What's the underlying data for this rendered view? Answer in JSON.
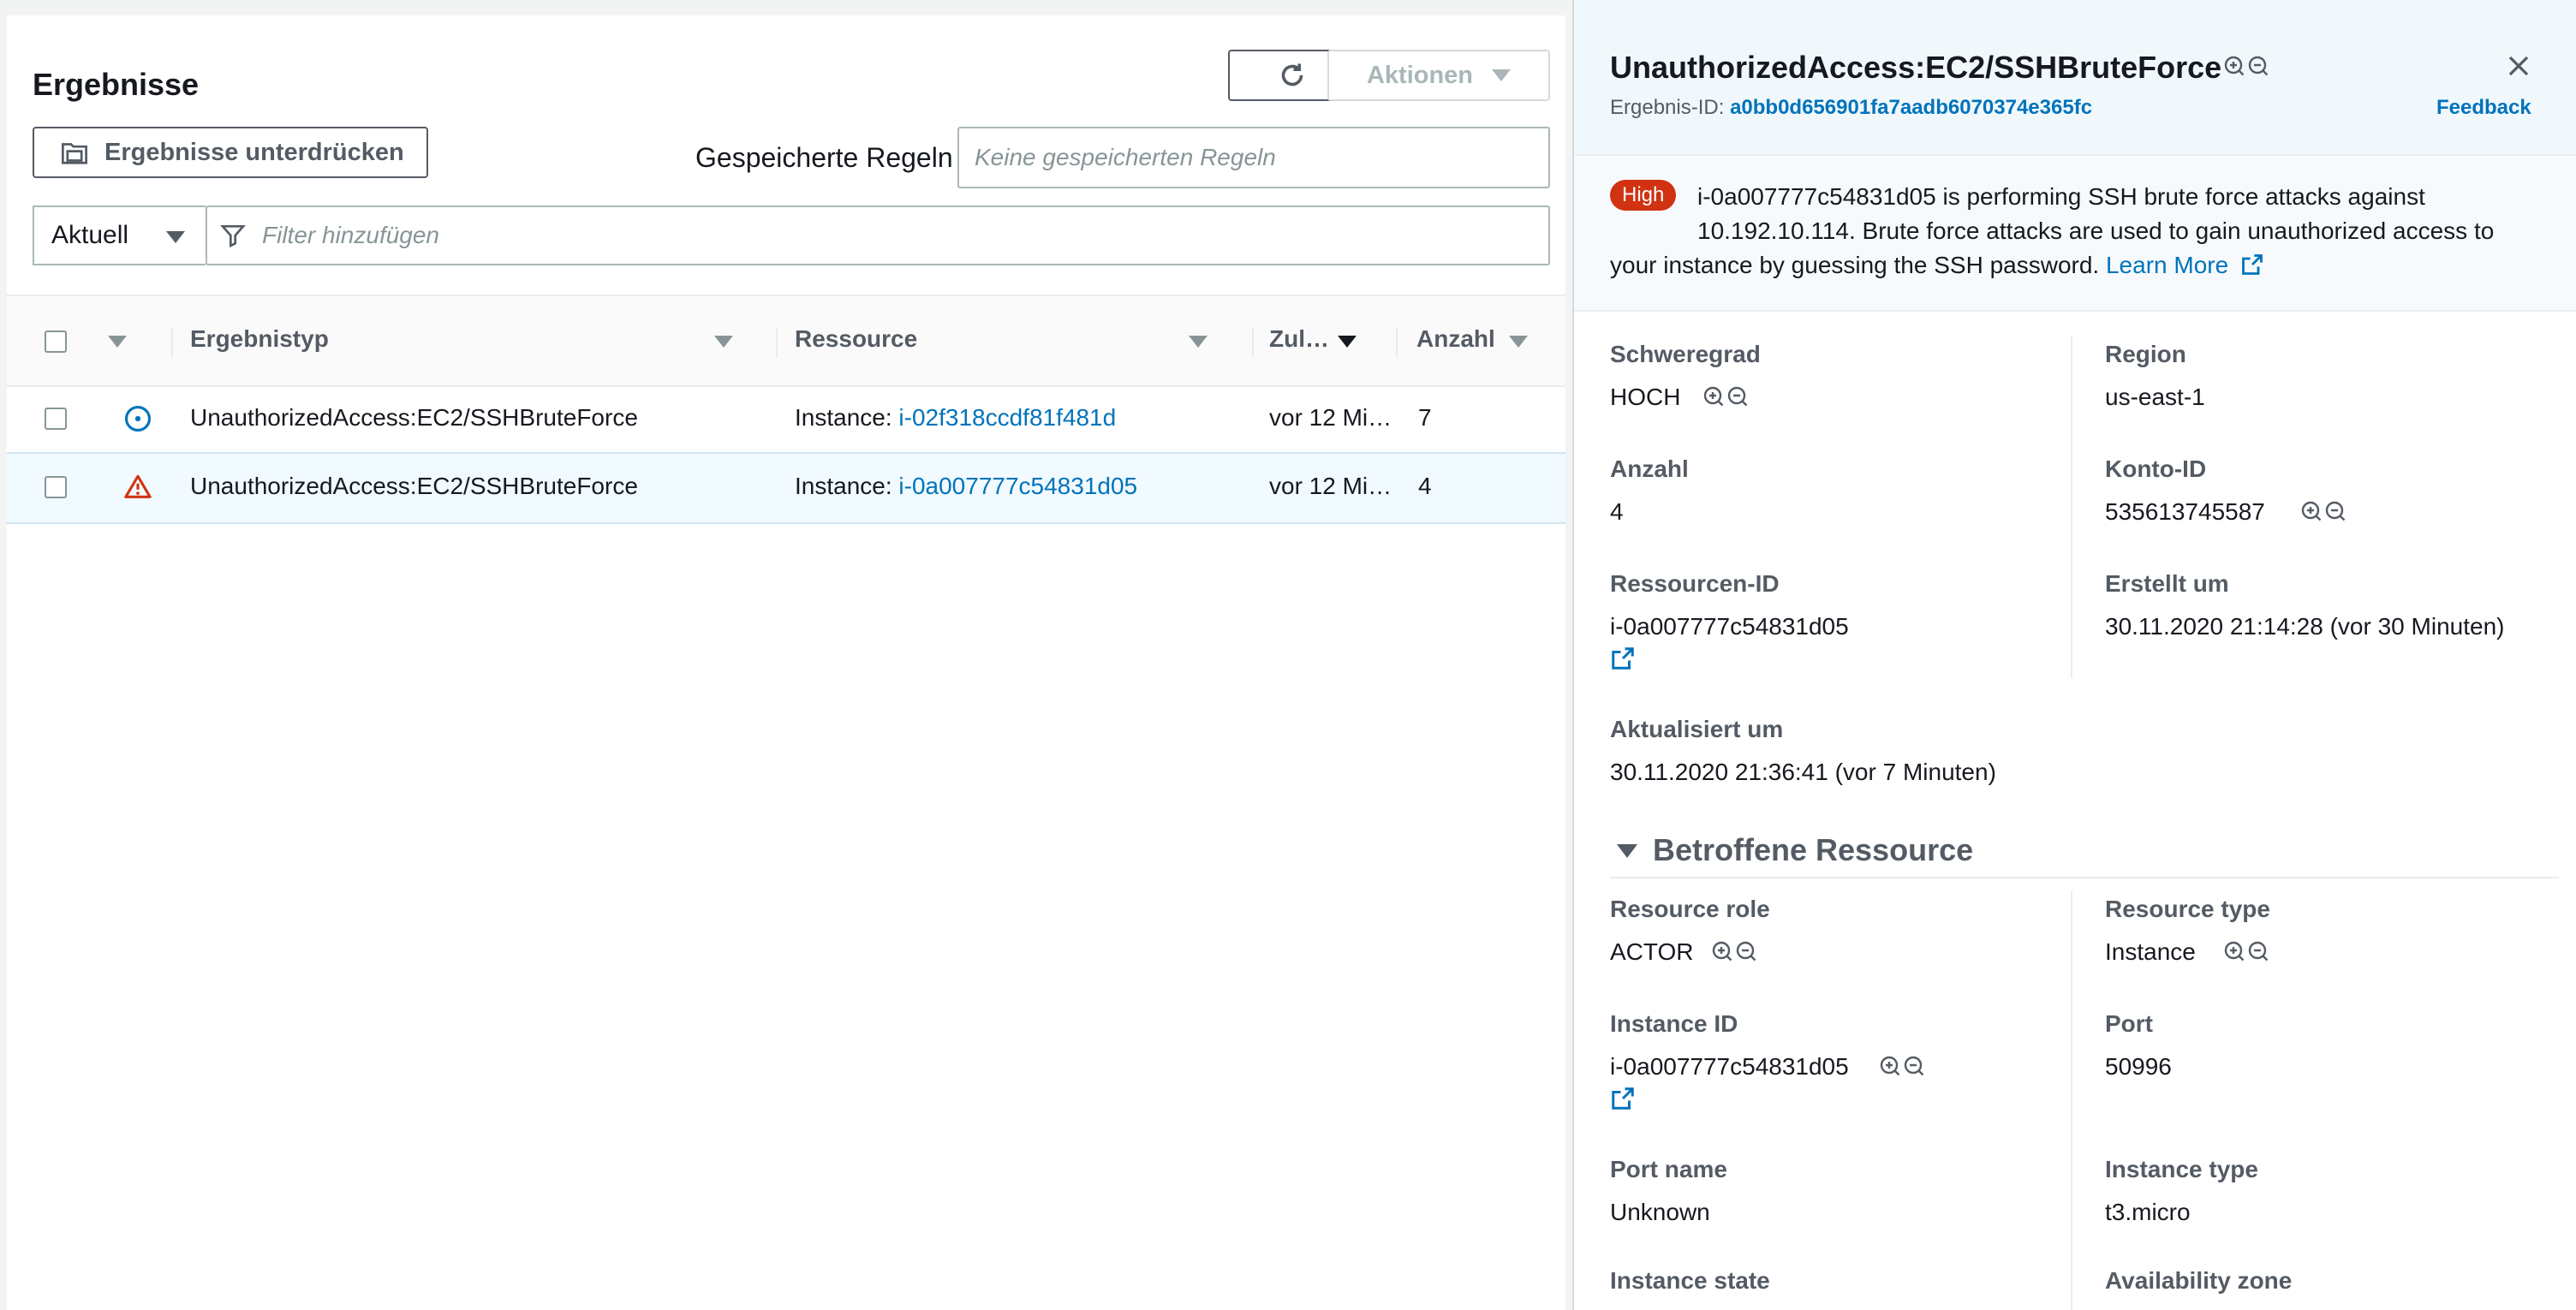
{
  "left": {
    "title": "Ergebnisse",
    "refresh_icon": "refresh-icon",
    "actions_label": "Aktionen",
    "suppress_label": "Ergebnisse unterdrücken",
    "saved_rules_label": "Gespeicherte Regeln",
    "saved_rules_placeholder": "Keine gespeicherten Regeln",
    "view_select": "Aktuell",
    "filter_placeholder": "Filter hinzufügen",
    "columns": [
      "Ergebnistyp",
      "Ressource",
      "Zul…",
      "Anzahl"
    ],
    "rows": [
      {
        "severity_icon": "info-circle-icon",
        "type": "UnauthorizedAccess:EC2/SSHBruteForce",
        "resource_prefix": "Instance: ",
        "resource_link": "i-02f318ccdf81f481d",
        "updated": "vor 12 Mi…",
        "count": "7",
        "selected": false
      },
      {
        "severity_icon": "warning-triangle-icon",
        "type": "UnauthorizedAccess:EC2/SSHBruteForce",
        "resource_prefix": "Instance: ",
        "resource_link": "i-0a007777c54831d05",
        "updated": "vor 12 Mi…",
        "count": "4",
        "selected": true
      }
    ]
  },
  "detail": {
    "title": "UnauthorizedAccess:EC2/SSHBruteForce",
    "finding_id_label": "Ergebnis-ID:",
    "finding_id": "a0bb0d656901fa7aadb6070374e365fc",
    "feedback": "Feedback",
    "badge": "High",
    "desc_line1": "i-0a007777c54831d05 is performing SSH brute force attacks against",
    "desc_line2": "10.192.10.114. Brute force attacks are used to gain unauthorized access to",
    "desc_line3": "your instance by guessing the SSH password.",
    "learn_more": "Learn More",
    "severity_label": "Schweregrad",
    "severity_value": "HOCH",
    "region_label": "Region",
    "region_value": "us-east-1",
    "count_label": "Anzahl",
    "count_value": "4",
    "account_label": "Konto-ID",
    "account_value": "535613745587",
    "resource_id_label": "Ressourcen-ID",
    "resource_id_value": "i-0a007777c54831d05",
    "created_label": "Erstellt um",
    "created_value": "30.11.2020 21:14:28 (vor 30 Minuten)",
    "updated_label": "Aktualisiert um",
    "updated_value": "30.11.2020 21:36:41 (vor 7 Minuten)",
    "section_title": "Betroffene Ressource",
    "resource_role_label": "Resource role",
    "resource_role_value": "ACTOR",
    "resource_type_label": "Resource type",
    "resource_type_value": "Instance",
    "instance_id_label": "Instance ID",
    "instance_id_value": "i-0a007777c54831d05",
    "port_label": "Port",
    "port_value": "50996",
    "port_name_label": "Port name",
    "port_name_value": "Unknown",
    "instance_type_label": "Instance type",
    "instance_type_value": "t3.micro",
    "instance_state_label": "Instance state",
    "availability_zone_label": "Availability zone"
  },
  "colors": {
    "link": "#0073bb",
    "high_badge": "#d13212",
    "selected_row": "#f1faff"
  }
}
